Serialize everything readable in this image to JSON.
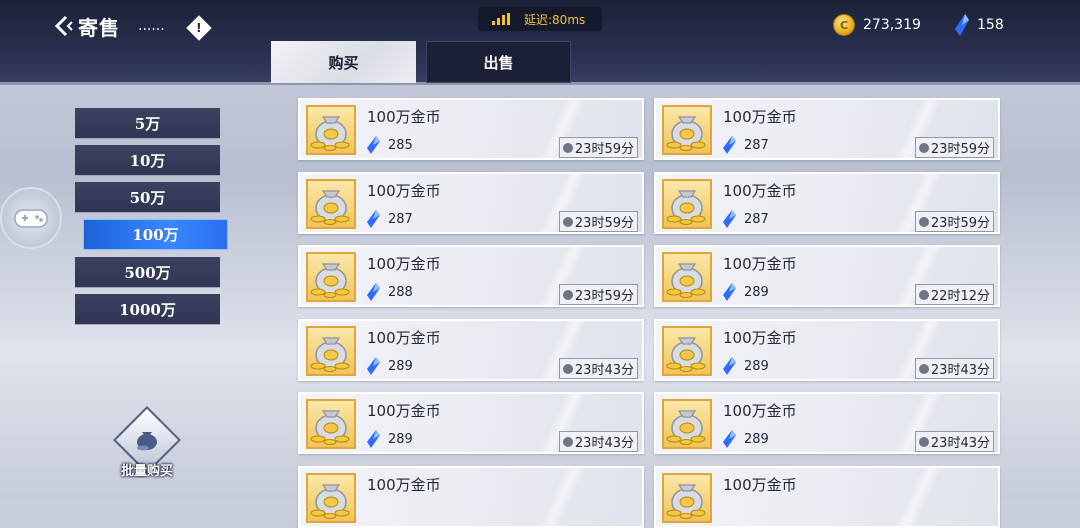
{
  "header": {
    "title": "寄售",
    "title_suffix": "......",
    "info_symbol": "!",
    "latency_label": "延迟:80ms",
    "gold": "273,319",
    "gems": "158"
  },
  "tabs": [
    {
      "label": "购买",
      "active": true
    },
    {
      "label": "出售",
      "active": false
    }
  ],
  "filters": [
    {
      "label": "5万",
      "active": false
    },
    {
      "label": "10万",
      "active": false
    },
    {
      "label": "50万",
      "active": false
    },
    {
      "label": "100万",
      "active": true
    },
    {
      "label": "500万",
      "active": false
    },
    {
      "label": "1000万",
      "active": false
    }
  ],
  "bulk_buy_label": "批量购买",
  "colors": {
    "accent": "#3a86ff",
    "header": "#1c2238",
    "gold": "#f1c232"
  },
  "listings": [
    {
      "name": "100万金币",
      "price": "285",
      "time": "23时59分"
    },
    {
      "name": "100万金币",
      "price": "287",
      "time": "23时59分"
    },
    {
      "name": "100万金币",
      "price": "287",
      "time": "23时59分"
    },
    {
      "name": "100万金币",
      "price": "287",
      "time": "23时59分"
    },
    {
      "name": "100万金币",
      "price": "288",
      "time": "23时59分"
    },
    {
      "name": "100万金币",
      "price": "289",
      "time": "22时12分"
    },
    {
      "name": "100万金币",
      "price": "289",
      "time": "23时43分"
    },
    {
      "name": "100万金币",
      "price": "289",
      "time": "23时43分"
    },
    {
      "name": "100万金币",
      "price": "289",
      "time": "23时43分"
    },
    {
      "name": "100万金币",
      "price": "289",
      "time": "23时43分"
    },
    {
      "name": "100万金币",
      "price": "",
      "time": ""
    },
    {
      "name": "100万金币",
      "price": "",
      "time": ""
    }
  ]
}
